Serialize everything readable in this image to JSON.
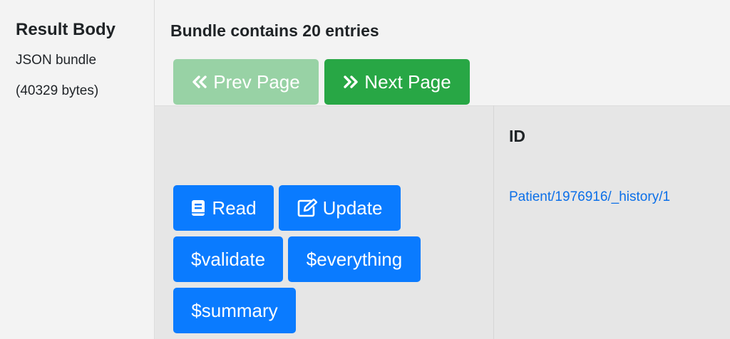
{
  "sidebar": {
    "heading": "Result Body",
    "type_line": "JSON bundle",
    "size_line": "(40329 bytes)"
  },
  "main": {
    "bundle_title": "Bundle contains 20 entries",
    "pagination": {
      "prev_label": "Prev Page",
      "next_label": "Next Page",
      "prev_icon": "double-chevron-left-icon",
      "next_icon": "double-chevron-right-icon"
    },
    "table": {
      "columns": [
        "",
        "ID"
      ],
      "rows": [
        {
          "actions": [
            {
              "label": "Read",
              "icon": "book-icon"
            },
            {
              "label": "Update",
              "icon": "edit-icon"
            },
            {
              "label": "$validate"
            },
            {
              "label": "$everything"
            },
            {
              "label": "$summary"
            }
          ],
          "id": "Patient/1976916/_history/1"
        }
      ]
    }
  },
  "colors": {
    "success": "#28a745",
    "success_disabled": "#98d2a5",
    "primary": "#0a7bff",
    "link": "#0b6fe8"
  }
}
